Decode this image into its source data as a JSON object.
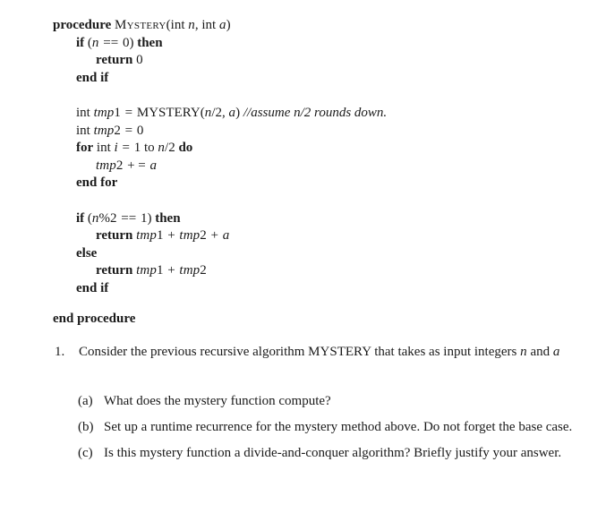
{
  "document": {
    "type": "algorithms-homework-pseudocode",
    "background_color": "#ffffff",
    "text_color": "#1a1a1a"
  },
  "algorithm": {
    "name": "MYSTERY",
    "lines": [
      {
        "id": "line-procedure-header",
        "indent": 0,
        "parts": [
          {
            "style": "kw",
            "text": "procedure"
          },
          {
            "style": "space",
            "text": " "
          },
          {
            "style": "smallcaps",
            "text": "Mystery"
          },
          {
            "style": "rm",
            "text": "(int "
          },
          {
            "style": "mathit",
            "text": "n"
          },
          {
            "style": "rm",
            "text": ", int "
          },
          {
            "style": "mathit",
            "text": "a"
          },
          {
            "style": "rm",
            "text": ")"
          }
        ],
        "plain": "procedure MYSTERY(int n, int a)"
      },
      {
        "id": "line-if-n-zero",
        "indent": 1,
        "parts": [
          {
            "style": "kw",
            "text": "if"
          },
          {
            "style": "rm",
            "text": " ("
          },
          {
            "style": "mathit",
            "text": "n"
          },
          {
            "style": "op",
            "text": " == "
          },
          {
            "style": "rm",
            "text": "0) "
          },
          {
            "style": "kw",
            "text": "then"
          }
        ],
        "plain": "if (n == 0) then"
      },
      {
        "id": "line-return-zero",
        "indent": 2,
        "parts": [
          {
            "style": "kw",
            "text": "return"
          },
          {
            "style": "rm",
            "text": " 0"
          }
        ],
        "plain": "return 0"
      },
      {
        "id": "line-end-if-1",
        "indent": 1,
        "parts": [
          {
            "style": "kw",
            "text": "end if"
          }
        ],
        "plain": "end if"
      },
      {
        "id": "line-blank-1",
        "indent": 0,
        "blank": true,
        "parts": [],
        "plain": ""
      },
      {
        "id": "line-tmp1-assign",
        "indent": 1,
        "parts": [
          {
            "style": "rm",
            "text": "int "
          },
          {
            "style": "mathit",
            "text": "tmp"
          },
          {
            "style": "num",
            "text": "1"
          },
          {
            "style": "op",
            "text": " = "
          },
          {
            "style": "caps",
            "text": "MYSTERY"
          },
          {
            "style": "rm",
            "text": "("
          },
          {
            "style": "mathit",
            "text": "n"
          },
          {
            "style": "rm",
            "text": "/2, "
          },
          {
            "style": "mathit",
            "text": "a"
          },
          {
            "style": "rm",
            "text": ") "
          },
          {
            "style": "comment",
            "text": "//assume n/2 rounds down."
          }
        ],
        "plain": "int tmp1 = MYSTERY(n/2, a) //assume n/2 rounds down."
      },
      {
        "id": "line-tmp2-init",
        "indent": 1,
        "parts": [
          {
            "style": "rm",
            "text": "int "
          },
          {
            "style": "mathit",
            "text": "tmp"
          },
          {
            "style": "num",
            "text": "2"
          },
          {
            "style": "op",
            "text": " = "
          },
          {
            "style": "rm",
            "text": "0"
          }
        ],
        "plain": "int tmp2 = 0"
      },
      {
        "id": "line-for-loop",
        "indent": 1,
        "parts": [
          {
            "style": "kw",
            "text": "for"
          },
          {
            "style": "rm",
            "text": " int "
          },
          {
            "style": "mathit",
            "text": "i"
          },
          {
            "style": "op",
            "text": " = "
          },
          {
            "style": "rm",
            "text": "1 to "
          },
          {
            "style": "mathit",
            "text": "n"
          },
          {
            "style": "rm",
            "text": "/2 "
          },
          {
            "style": "kw",
            "text": "do"
          }
        ],
        "plain": "for int i = 1 to n/2 do"
      },
      {
        "id": "line-tmp2-accumulate",
        "indent": 2,
        "parts": [
          {
            "style": "mathit",
            "text": "tmp"
          },
          {
            "style": "num",
            "text": "2"
          },
          {
            "style": "op",
            "text": " + = "
          },
          {
            "style": "mathit",
            "text": "a"
          }
        ],
        "plain": "tmp2 + = a"
      },
      {
        "id": "line-end-for",
        "indent": 1,
        "parts": [
          {
            "style": "kw",
            "text": "end for"
          }
        ],
        "plain": "end for"
      },
      {
        "id": "line-blank-2",
        "indent": 0,
        "blank": true,
        "parts": [],
        "plain": ""
      },
      {
        "id": "line-if-odd",
        "indent": 1,
        "parts": [
          {
            "style": "kw",
            "text": "if"
          },
          {
            "style": "rm",
            "text": " ("
          },
          {
            "style": "mathit",
            "text": "n"
          },
          {
            "style": "rm",
            "text": "%2"
          },
          {
            "style": "op",
            "text": " == "
          },
          {
            "style": "rm",
            "text": "1) "
          },
          {
            "style": "kw",
            "text": "then"
          }
        ],
        "plain": "if (n%2 == 1) then"
      },
      {
        "id": "line-return-odd",
        "indent": 2,
        "parts": [
          {
            "style": "kw",
            "text": "return"
          },
          {
            "style": "rm",
            "text": " "
          },
          {
            "style": "mathit",
            "text": "tmp"
          },
          {
            "style": "num",
            "text": "1"
          },
          {
            "style": "op",
            "text": " + "
          },
          {
            "style": "mathit",
            "text": "tmp"
          },
          {
            "style": "num",
            "text": "2"
          },
          {
            "style": "op",
            "text": " + "
          },
          {
            "style": "mathit",
            "text": "a"
          }
        ],
        "plain": "return tmp1 + tmp2 + a"
      },
      {
        "id": "line-else",
        "indent": 1,
        "parts": [
          {
            "style": "kw",
            "text": "else"
          }
        ],
        "plain": "else"
      },
      {
        "id": "line-return-even",
        "indent": 2,
        "parts": [
          {
            "style": "kw",
            "text": "return"
          },
          {
            "style": "rm",
            "text": " "
          },
          {
            "style": "mathit",
            "text": "tmp"
          },
          {
            "style": "num",
            "text": "1"
          },
          {
            "style": "op",
            "text": " + "
          },
          {
            "style": "mathit",
            "text": "tmp"
          },
          {
            "style": "num",
            "text": "2"
          }
        ],
        "plain": "return tmp1 + tmp2"
      },
      {
        "id": "line-end-if-2",
        "indent": 1,
        "parts": [
          {
            "style": "kw",
            "text": "end if"
          }
        ],
        "plain": "end if"
      }
    ],
    "end_procedure_label": "end procedure"
  },
  "questions": [
    {
      "marker": "1.",
      "text_parts": [
        {
          "style": "rm",
          "text": "Consider the previous recursive algorithm MYSTERY that takes as input integers "
        },
        {
          "style": "mathit",
          "text": "n"
        },
        {
          "style": "rm",
          "text": " and "
        },
        {
          "style": "mathit",
          "text": "a"
        }
      ],
      "plain": "Consider the previous recursive algorithm MYSTERY that takes as input integers n and a"
    }
  ],
  "sub_questions": [
    {
      "marker": "(a)",
      "text": "What does the mystery function compute?"
    },
    {
      "marker": "(b)",
      "text": "Set up a runtime recurrence for the mystery method above.  Do not forget the base case."
    },
    {
      "marker": "(c)",
      "text": "Is this mystery function a divide-and-conquer algorithm?  Briefly justify your answer."
    }
  ]
}
